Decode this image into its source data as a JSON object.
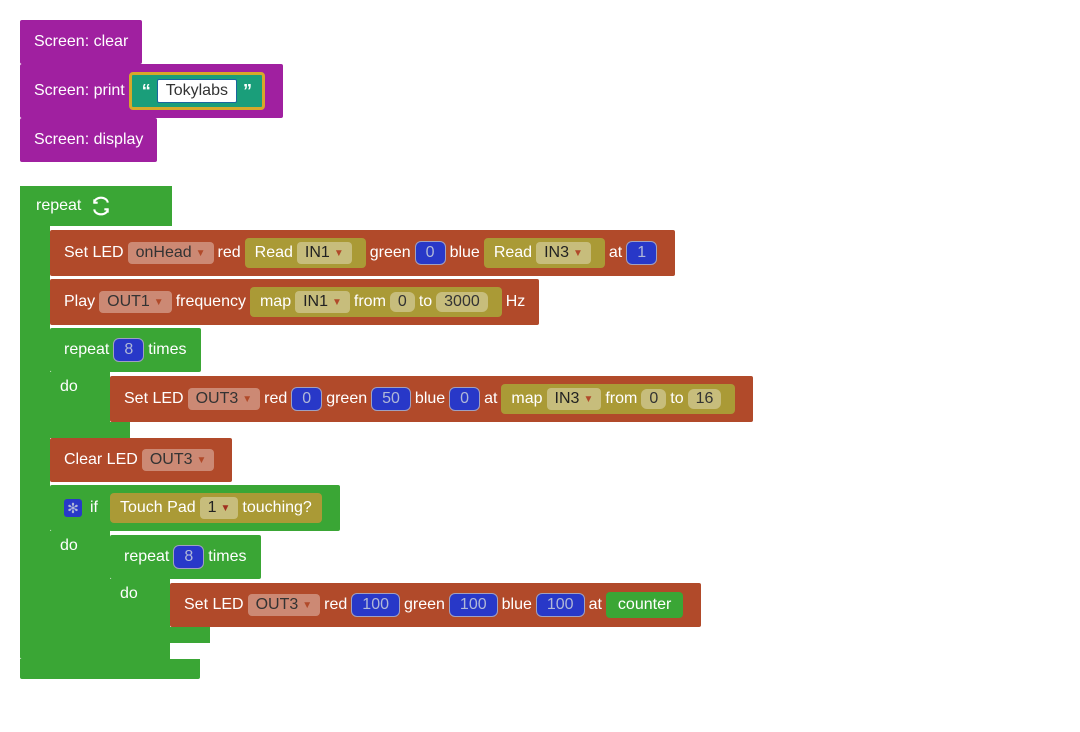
{
  "screen": {
    "clear": "Screen: clear",
    "print": "Screen: print",
    "printValue": "Tokylabs",
    "display": "Screen: display"
  },
  "repeat": {
    "label": "repeat"
  },
  "setLed1": {
    "label": "Set LED",
    "target": "onHead",
    "redLabel": "red",
    "greenLabel": "green",
    "blueLabel": "blue",
    "atLabel": "at",
    "read1Label": "Read",
    "read1Port": "IN1",
    "greenValue": "0",
    "read2Label": "Read",
    "read2Port": "IN3",
    "atValue": "1"
  },
  "play": {
    "label": "Play",
    "port": "OUT1",
    "freqLabel": "frequency",
    "mapLabel": "map",
    "mapPort": "IN1",
    "fromLabel": "from",
    "fromValue": "0",
    "toLabel": "to",
    "toValue": "3000",
    "hzLabel": "Hz"
  },
  "repeat8": {
    "label": "repeat",
    "count": "8",
    "timesLabel": "times",
    "doLabel": "do"
  },
  "setLed2": {
    "label": "Set LED",
    "target": "OUT3",
    "redLabel": "red",
    "redValue": "0",
    "greenLabel": "green",
    "greenValue": "50",
    "blueLabel": "blue",
    "blueValue": "0",
    "atLabel": "at",
    "mapLabel": "map",
    "mapPort": "IN3",
    "fromLabel": "from",
    "fromValue": "0",
    "toLabel": "to",
    "toValue": "16"
  },
  "clearLed": {
    "label": "Clear LED",
    "port": "OUT3"
  },
  "ifBlock": {
    "ifLabel": "if",
    "doLabel": "do",
    "touchLabel": "Touch Pad",
    "touchNum": "1",
    "touchingLabel": "touching?"
  },
  "repeat8b": {
    "label": "repeat",
    "count": "8",
    "timesLabel": "times",
    "doLabel": "do"
  },
  "setLed3": {
    "label": "Set LED",
    "target": "OUT3",
    "redLabel": "red",
    "redValue": "100",
    "greenLabel": "green",
    "greenValue": "100",
    "blueLabel": "blue",
    "blueValue": "100",
    "atLabel": "at",
    "counterLabel": "counter"
  }
}
